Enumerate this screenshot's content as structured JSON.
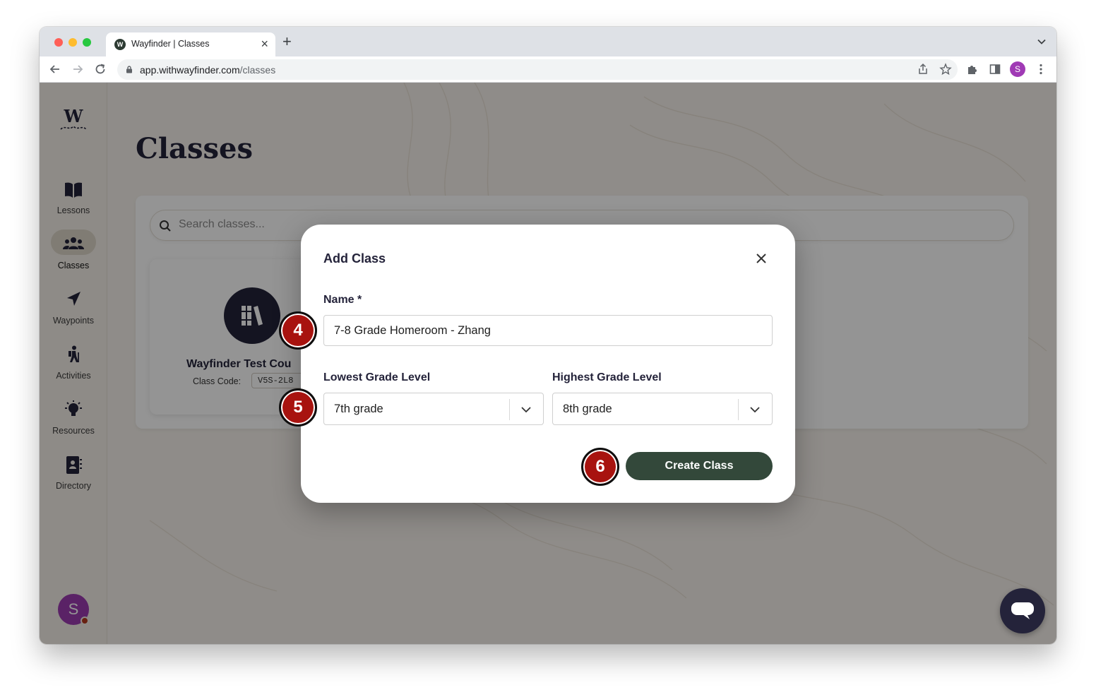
{
  "browser": {
    "tab_title": "Wayfinder | Classes",
    "favicon_letter": "W",
    "url_host": "app.withwayfinder.com",
    "url_path": "/classes",
    "profile_initial": "S"
  },
  "sidebar": {
    "logo_letter": "W",
    "items": [
      {
        "label": "Lessons",
        "icon": "book-icon"
      },
      {
        "label": "Classes",
        "icon": "users-icon",
        "active": true
      },
      {
        "label": "Waypoints",
        "icon": "navigation-arrow-icon"
      },
      {
        "label": "Activities",
        "icon": "hiker-icon"
      },
      {
        "label": "Resources",
        "icon": "lightbulb-icon"
      },
      {
        "label": "Directory",
        "icon": "contact-book-icon"
      }
    ],
    "user_initial": "S"
  },
  "page": {
    "title": "Classes",
    "search_placeholder": "Search classes...",
    "class_card": {
      "name": "Wayfinder Test Cou",
      "code_label": "Class Code:",
      "code_value": "V5S-2L8"
    }
  },
  "modal": {
    "title": "Add Class",
    "name_label": "Name *",
    "name_value": "7-8 Grade Homeroom - Zhang",
    "lowest_label": "Lowest Grade Level",
    "lowest_value": "7th grade",
    "highest_label": "Highest Grade Level",
    "highest_value": "8th grade",
    "submit_label": "Create Class"
  },
  "steps": {
    "step_4": "4",
    "step_5": "5",
    "step_6": "6"
  },
  "colors": {
    "brand_dark": "#24233a",
    "button_green": "#33483a",
    "step_badge": "#a8130f",
    "avatar_purple": "#9c3cb0"
  }
}
